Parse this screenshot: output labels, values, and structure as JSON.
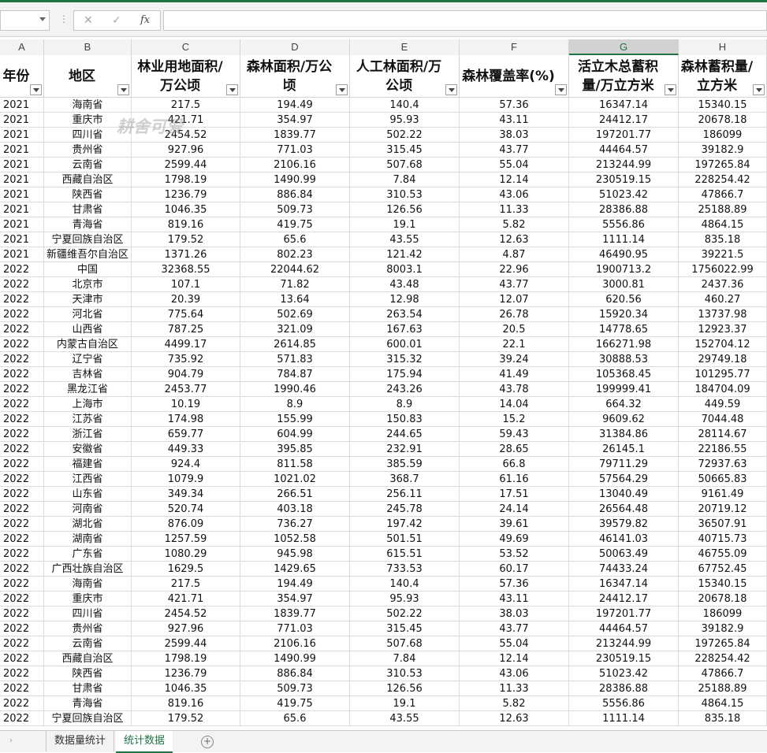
{
  "formula_bar": {
    "name_box": "",
    "cancel_icon": "✕",
    "enter_icon": "✓",
    "fx_label": "fx",
    "formula_value": ""
  },
  "columns": [
    "A",
    "B",
    "C",
    "D",
    "E",
    "F",
    "G",
    "H"
  ],
  "selected_column": "G",
  "headers": [
    "年份",
    "地区",
    "林业用地面积/万公顷",
    "森林面积/万公顷",
    "人工林面积/万公顷",
    "森林覆盖率(%)",
    "活立木总蓄积量/万立方米",
    "森林蓄积量/立方米"
  ],
  "watermark": "耕舍可爱",
  "rows": [
    [
      "2021",
      "海南省",
      "217.5",
      "194.49",
      "140.4",
      "57.36",
      "16347.14",
      "15340.15"
    ],
    [
      "2021",
      "重庆市",
      "421.71",
      "354.97",
      "95.93",
      "43.11",
      "24412.17",
      "20678.18"
    ],
    [
      "2021",
      "四川省",
      "2454.52",
      "1839.77",
      "502.22",
      "38.03",
      "197201.77",
      "186099"
    ],
    [
      "2021",
      "贵州省",
      "927.96",
      "771.03",
      "315.45",
      "43.77",
      "44464.57",
      "39182.9"
    ],
    [
      "2021",
      "云南省",
      "2599.44",
      "2106.16",
      "507.68",
      "55.04",
      "213244.99",
      "197265.84"
    ],
    [
      "2021",
      "西藏自治区",
      "1798.19",
      "1490.99",
      "7.84",
      "12.14",
      "230519.15",
      "228254.42"
    ],
    [
      "2021",
      "陕西省",
      "1236.79",
      "886.84",
      "310.53",
      "43.06",
      "51023.42",
      "47866.7"
    ],
    [
      "2021",
      "甘肃省",
      "1046.35",
      "509.73",
      "126.56",
      "11.33",
      "28386.88",
      "25188.89"
    ],
    [
      "2021",
      "青海省",
      "819.16",
      "419.75",
      "19.1",
      "5.82",
      "5556.86",
      "4864.15"
    ],
    [
      "2021",
      "宁夏回族自治区",
      "179.52",
      "65.6",
      "43.55",
      "12.63",
      "1111.14",
      "835.18"
    ],
    [
      "2021",
      "新疆维吾尔自治区",
      "1371.26",
      "802.23",
      "121.42",
      "4.87",
      "46490.95",
      "39221.5"
    ],
    [
      "2022",
      "中国",
      "32368.55",
      "22044.62",
      "8003.1",
      "22.96",
      "1900713.2",
      "1756022.99"
    ],
    [
      "2022",
      "北京市",
      "107.1",
      "71.82",
      "43.48",
      "43.77",
      "3000.81",
      "2437.36"
    ],
    [
      "2022",
      "天津市",
      "20.39",
      "13.64",
      "12.98",
      "12.07",
      "620.56",
      "460.27"
    ],
    [
      "2022",
      "河北省",
      "775.64",
      "502.69",
      "263.54",
      "26.78",
      "15920.34",
      "13737.98"
    ],
    [
      "2022",
      "山西省",
      "787.25",
      "321.09",
      "167.63",
      "20.5",
      "14778.65",
      "12923.37"
    ],
    [
      "2022",
      "内蒙古自治区",
      "4499.17",
      "2614.85",
      "600.01",
      "22.1",
      "166271.98",
      "152704.12"
    ],
    [
      "2022",
      "辽宁省",
      "735.92",
      "571.83",
      "315.32",
      "39.24",
      "30888.53",
      "29749.18"
    ],
    [
      "2022",
      "吉林省",
      "904.79",
      "784.87",
      "175.94",
      "41.49",
      "105368.45",
      "101295.77"
    ],
    [
      "2022",
      "黑龙江省",
      "2453.77",
      "1990.46",
      "243.26",
      "43.78",
      "199999.41",
      "184704.09"
    ],
    [
      "2022",
      "上海市",
      "10.19",
      "8.9",
      "8.9",
      "14.04",
      "664.32",
      "449.59"
    ],
    [
      "2022",
      "江苏省",
      "174.98",
      "155.99",
      "150.83",
      "15.2",
      "9609.62",
      "7044.48"
    ],
    [
      "2022",
      "浙江省",
      "659.77",
      "604.99",
      "244.65",
      "59.43",
      "31384.86",
      "28114.67"
    ],
    [
      "2022",
      "安徽省",
      "449.33",
      "395.85",
      "232.91",
      "28.65",
      "26145.1",
      "22186.55"
    ],
    [
      "2022",
      "福建省",
      "924.4",
      "811.58",
      "385.59",
      "66.8",
      "79711.29",
      "72937.63"
    ],
    [
      "2022",
      "江西省",
      "1079.9",
      "1021.02",
      "368.7",
      "61.16",
      "57564.29",
      "50665.83"
    ],
    [
      "2022",
      "山东省",
      "349.34",
      "266.51",
      "256.11",
      "17.51",
      "13040.49",
      "9161.49"
    ],
    [
      "2022",
      "河南省",
      "520.74",
      "403.18",
      "245.78",
      "24.14",
      "26564.48",
      "20719.12"
    ],
    [
      "2022",
      "湖北省",
      "876.09",
      "736.27",
      "197.42",
      "39.61",
      "39579.82",
      "36507.91"
    ],
    [
      "2022",
      "湖南省",
      "1257.59",
      "1052.58",
      "501.51",
      "49.69",
      "46141.03",
      "40715.73"
    ],
    [
      "2022",
      "广东省",
      "1080.29",
      "945.98",
      "615.51",
      "53.52",
      "50063.49",
      "46755.09"
    ],
    [
      "2022",
      "广西壮族自治区",
      "1629.5",
      "1429.65",
      "733.53",
      "60.17",
      "74433.24",
      "67752.45"
    ],
    [
      "2022",
      "海南省",
      "217.5",
      "194.49",
      "140.4",
      "57.36",
      "16347.14",
      "15340.15"
    ],
    [
      "2022",
      "重庆市",
      "421.71",
      "354.97",
      "95.93",
      "43.11",
      "24412.17",
      "20678.18"
    ],
    [
      "2022",
      "四川省",
      "2454.52",
      "1839.77",
      "502.22",
      "38.03",
      "197201.77",
      "186099"
    ],
    [
      "2022",
      "贵州省",
      "927.96",
      "771.03",
      "315.45",
      "43.77",
      "44464.57",
      "39182.9"
    ],
    [
      "2022",
      "云南省",
      "2599.44",
      "2106.16",
      "507.68",
      "55.04",
      "213244.99",
      "197265.84"
    ],
    [
      "2022",
      "西藏自治区",
      "1798.19",
      "1490.99",
      "7.84",
      "12.14",
      "230519.15",
      "228254.42"
    ],
    [
      "2022",
      "陕西省",
      "1236.79",
      "886.84",
      "310.53",
      "43.06",
      "51023.42",
      "47866.7"
    ],
    [
      "2022",
      "甘肃省",
      "1046.35",
      "509.73",
      "126.56",
      "11.33",
      "28386.88",
      "25188.89"
    ],
    [
      "2022",
      "青海省",
      "819.16",
      "419.75",
      "19.1",
      "5.82",
      "5556.86",
      "4864.15"
    ],
    [
      "2022",
      "宁夏回族自治区",
      "179.52",
      "65.6",
      "43.55",
      "12.63",
      "1111.14",
      "835.18"
    ]
  ],
  "sheet_tabs": [
    "数据量统计",
    "统计数据"
  ],
  "active_sheet": "统计数据",
  "colors": {
    "accent": "#217346"
  }
}
